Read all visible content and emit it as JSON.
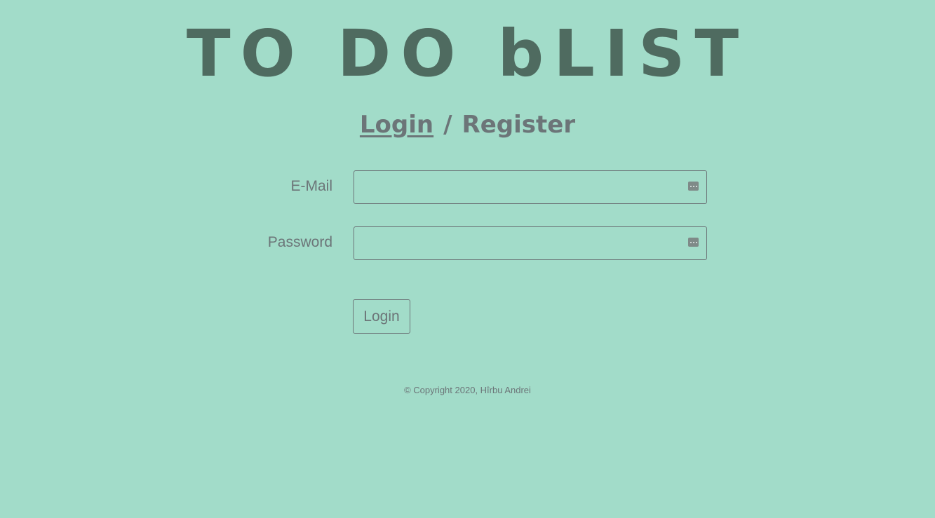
{
  "app": {
    "title": "TO DO bLIST"
  },
  "auth_tabs": {
    "login_label": "Login",
    "separator": "/",
    "register_label": "Register",
    "active": "Login"
  },
  "form": {
    "email_label": "E-Mail",
    "email_value": "",
    "password_label": "Password",
    "password_value": "",
    "submit_label": "Login"
  },
  "icons": {
    "autofill": "password-manager-key-icon"
  },
  "colors": {
    "background": "#a2dcc9",
    "title": "#4f6b60",
    "text": "#6c7578"
  },
  "footer": {
    "copyright": "© Copyright 2020, Hîrbu Andrei"
  }
}
